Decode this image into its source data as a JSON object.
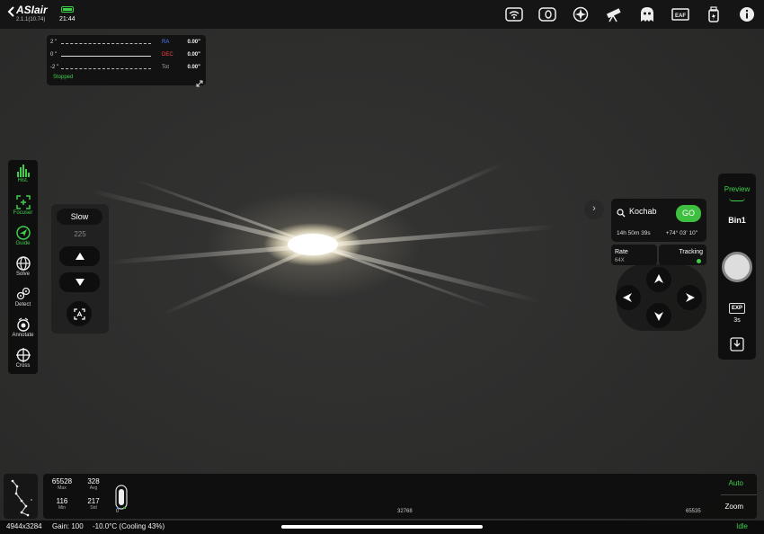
{
  "app": {
    "name": "ASIair",
    "version": "2.1.1(10.74)",
    "clock": "21:44"
  },
  "top_icons": [
    "wifi-icon",
    "storage-icon",
    "settings-icon",
    "telescope-icon",
    "ghost-icon",
    "eaf-icon",
    "usb-drive-icon",
    "info-icon"
  ],
  "guide": {
    "axis_top": "2 \"",
    "axis_mid": "0 \"",
    "axis_bot": "-2 \"",
    "ra_label": "RA",
    "ra_value": "0.00\"",
    "dec_label": "DEC",
    "dec_value": "0.00\"",
    "tot_label": "Tot",
    "tot_value": "0.00\"",
    "status": "Stopped",
    "colors": {
      "ra": "#4a7cff",
      "dec": "#ff4040"
    }
  },
  "left_tools": [
    {
      "label": "Hist.",
      "icon": "histogram-icon",
      "active": true
    },
    {
      "label": "Focuser",
      "icon": "focuser-icon",
      "active": true
    },
    {
      "label": "Guide",
      "icon": "guide-icon",
      "active": true
    },
    {
      "label": "Solve",
      "icon": "globe-icon",
      "active": false
    },
    {
      "label": "Detect",
      "icon": "detect-icon",
      "active": false
    },
    {
      "label": "Annotate",
      "icon": "annotate-icon",
      "active": false
    },
    {
      "label": "Cross",
      "icon": "crosshair-icon",
      "active": false
    }
  ],
  "focuser": {
    "speed": "Slow",
    "steps": "225"
  },
  "goto": {
    "target": "Kochab",
    "go_label": "GO",
    "ra": "14h 50m 39s",
    "dec": "+74° 03' 10\""
  },
  "mount": {
    "rate_label": "Rate",
    "rate_value": "64X",
    "tracking_label": "Tracking"
  },
  "camera": {
    "mode": "Preview",
    "bin": "Bin1",
    "exp_badge": "EXP",
    "exposure": "3s"
  },
  "histogram": {
    "max_value": "65528",
    "max_label": "Max",
    "avg_value": "328",
    "avg_label": "Avg",
    "min_value": "116",
    "min_label": "Min",
    "std_value": "217",
    "std_label": "Std",
    "tick_start": "0",
    "tick_mid": "32768",
    "tick_end": "65535",
    "auto_label": "Auto",
    "zoom_label": "Zoom"
  },
  "status_bar": {
    "resolution": "4944x3284",
    "gain": "Gain: 100",
    "temperature": "-10.0°C (Cooling 43%)",
    "state": "Idle"
  },
  "accent_color": "#3fcf4a"
}
